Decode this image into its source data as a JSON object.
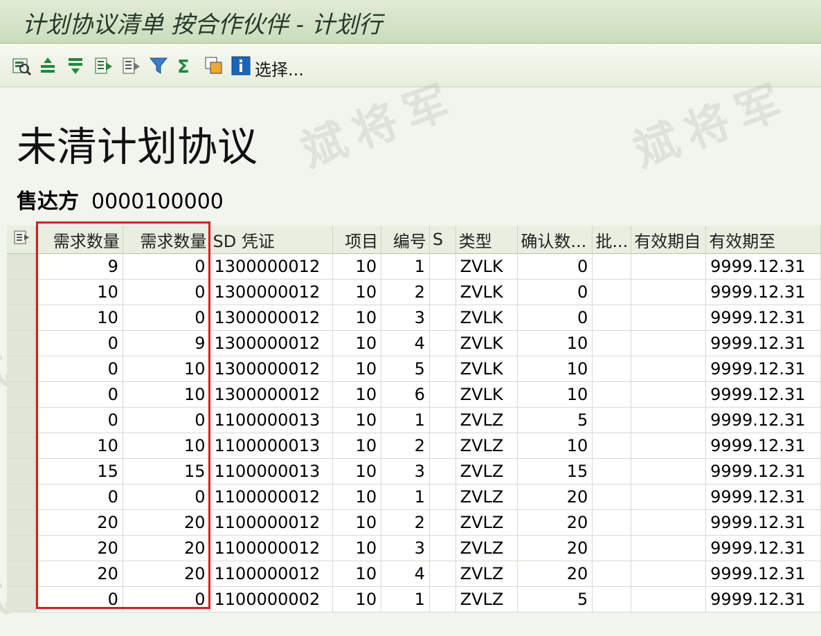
{
  "window": {
    "title": "计划协议清单 按合作伙伴 - 计划行"
  },
  "toolbar": {
    "buttons": [
      {
        "icon": "details-icon"
      },
      {
        "icon": "sort-ascending-icon"
      },
      {
        "icon": "sort-descending-icon"
      },
      {
        "icon": "export-icon"
      },
      {
        "icon": "print-icon"
      },
      {
        "icon": "filter-icon"
      },
      {
        "icon": "sum-icon"
      },
      {
        "icon": "layout-icon"
      },
      {
        "icon": "info-icon"
      }
    ],
    "select_label": "选择..."
  },
  "page": {
    "heading": "未清计划协议",
    "sold_to_label": "售达方",
    "sold_to_value": "0000100000"
  },
  "watermark": "斌将军",
  "table": {
    "columns": [
      "需求数量",
      "需求数量",
      "SD 凭证",
      "项目",
      "编号",
      "S",
      "类型",
      "确认数...",
      "批...",
      "有效期自",
      "有效期至"
    ],
    "rows": [
      [
        "9",
        "0",
        "1300000012",
        "10",
        "1",
        "",
        "ZVLK",
        "0",
        "",
        "",
        "9999.12.31"
      ],
      [
        "10",
        "0",
        "1300000012",
        "10",
        "2",
        "",
        "ZVLK",
        "0",
        "",
        "",
        "9999.12.31"
      ],
      [
        "10",
        "0",
        "1300000012",
        "10",
        "3",
        "",
        "ZVLK",
        "0",
        "",
        "",
        "9999.12.31"
      ],
      [
        "0",
        "9",
        "1300000012",
        "10",
        "4",
        "",
        "ZVLK",
        "10",
        "",
        "",
        "9999.12.31"
      ],
      [
        "0",
        "10",
        "1300000012",
        "10",
        "5",
        "",
        "ZVLK",
        "10",
        "",
        "",
        "9999.12.31"
      ],
      [
        "0",
        "10",
        "1300000012",
        "10",
        "6",
        "",
        "ZVLK",
        "10",
        "",
        "",
        "9999.12.31"
      ],
      [
        "0",
        "0",
        "1100000013",
        "10",
        "1",
        "",
        "ZVLZ",
        "5",
        "",
        "",
        "9999.12.31"
      ],
      [
        "10",
        "10",
        "1100000013",
        "10",
        "2",
        "",
        "ZVLZ",
        "10",
        "",
        "",
        "9999.12.31"
      ],
      [
        "15",
        "15",
        "1100000013",
        "10",
        "3",
        "",
        "ZVLZ",
        "15",
        "",
        "",
        "9999.12.31"
      ],
      [
        "0",
        "0",
        "1100000012",
        "10",
        "1",
        "",
        "ZVLZ",
        "20",
        "",
        "",
        "9999.12.31"
      ],
      [
        "20",
        "20",
        "1100000012",
        "10",
        "2",
        "",
        "ZVLZ",
        "20",
        "",
        "",
        "9999.12.31"
      ],
      [
        "20",
        "20",
        "1100000012",
        "10",
        "3",
        "",
        "ZVLZ",
        "20",
        "",
        "",
        "9999.12.31"
      ],
      [
        "20",
        "20",
        "1100000012",
        "10",
        "4",
        "",
        "ZVLZ",
        "20",
        "",
        "",
        "9999.12.31"
      ],
      [
        "0",
        "0",
        "1100000002",
        "10",
        "1",
        "",
        "ZVLZ",
        "5",
        "",
        "",
        "9999.12.31"
      ]
    ]
  },
  "colors": {
    "highlight_box": "#e0181e",
    "title_bg": "#d2e2c4"
  }
}
